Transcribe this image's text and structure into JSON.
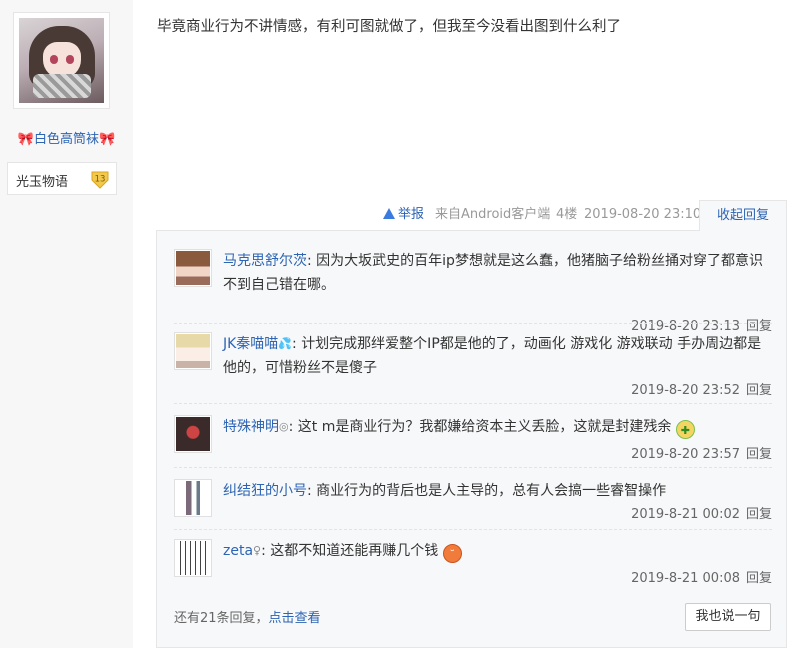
{
  "author": {
    "username": "白色高筒袜",
    "bow_left": "🎀",
    "bow_right": "🎀",
    "forum_name": "光玉物语",
    "level": "13"
  },
  "post": {
    "text": "毕竟商业行为不讲情感，有利可图就做了，但我至今没看出图到什么利了",
    "report_label": "举报",
    "source": "来自Android客户端",
    "floor": "4楼",
    "time": "2019-08-20 23:10",
    "collapse_label": "收起回复"
  },
  "replies": [
    {
      "user": "马克思舒尔茨",
      "suffix": "",
      "text": "因为大坂武史的百年ip梦想就是这么蠢，他猪脑子给粉丝捅对穿了都意识不到自己错在哪。",
      "time": "2019-8-20 23:13",
      "reply_label": "回复",
      "avatar_icon": "anime-avatar-brown"
    },
    {
      "user": "JK秦喵喵",
      "suffix": "💦",
      "text": "计划完成那绊爱整个IP都是他的了，动画化 游戏化 游戏联动 手办周边都是他的，可惜粉丝不是傻子",
      "time": "2019-8-20 23:52",
      "reply_label": "回复",
      "avatar_icon": "anime-avatar-light"
    },
    {
      "user": "特殊神明",
      "suffix": "◎",
      "text": "这t m是商业行为？我都嫌给资本主义丢脸，这就是封建残余",
      "emoji": "😷",
      "time": "2019-8-20 23:57",
      "reply_label": "回复",
      "avatar_icon": "anime-avatar-dark"
    },
    {
      "user": "纠结狂的小号",
      "suffix": "",
      "text": "商业行为的背后也是人主导的，总有人会搞一些睿智操作",
      "time": "2019-8-21 00:02",
      "reply_label": "回复",
      "avatar_icon": "figure-avatar"
    },
    {
      "user": "zeta",
      "suffix": "♀",
      "text": "这都不知道还能再赚几个钱",
      "emoji": "😡",
      "time": "2019-8-21 00:08",
      "reply_label": "回复",
      "avatar_icon": "text-avatar"
    }
  ],
  "footer": {
    "more_prefix": "还有21条回复，",
    "more_link": "点击查看",
    "say_button": "我也说一句"
  },
  "colors": {
    "link": "#2d64b3",
    "muted": "#999999",
    "panel": "#f7f8fa"
  }
}
